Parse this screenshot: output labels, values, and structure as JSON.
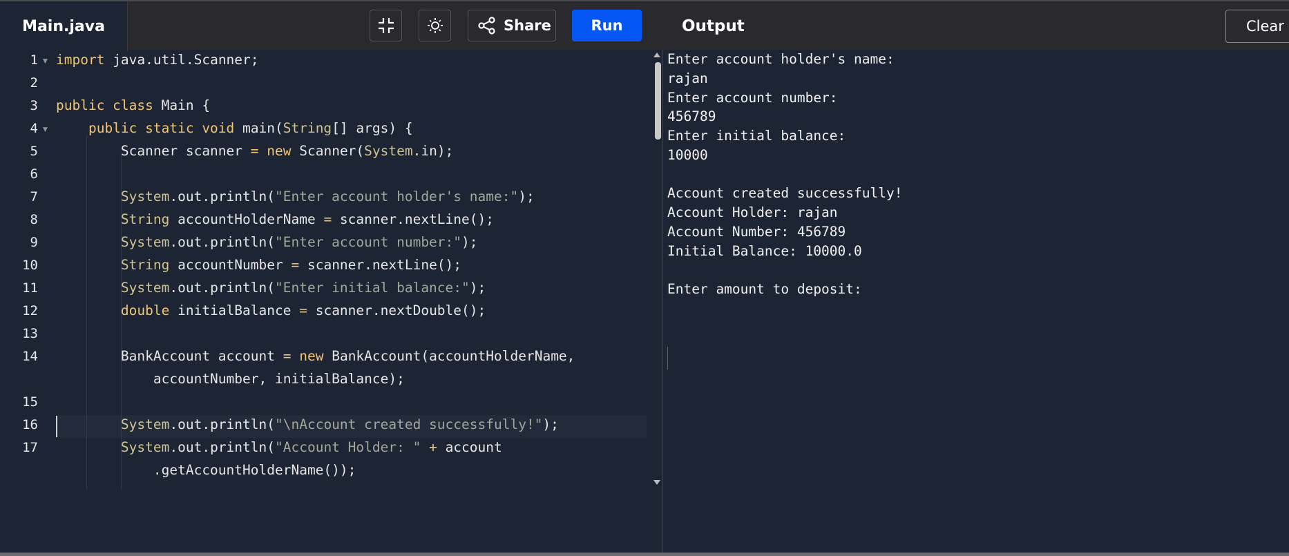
{
  "header": {
    "tab_label": "Main.java",
    "share_label": "Share",
    "run_label": "Run",
    "output_title": "Output",
    "clear_label": "Clear"
  },
  "icons": {
    "fullscreen": "collapse-icon",
    "theme": "sun-icon",
    "share": "share-icon"
  },
  "colors": {
    "run_button": "#0556f3",
    "editor_bg": "#1d2433",
    "keyword": "#f0c674",
    "string": "#a3a79a"
  },
  "editor": {
    "line_numbers": [
      "1",
      "2",
      "3",
      "4",
      "5",
      "6",
      "7",
      "8",
      "9",
      "10",
      "11",
      "12",
      "13",
      "14",
      "15",
      "16",
      "17"
    ],
    "lines": [
      {
        "segments": [
          {
            "t": "import",
            "c": "kw"
          },
          {
            "t": " java.util.Scanner;",
            "c": ""
          }
        ]
      },
      {
        "segments": []
      },
      {
        "segments": [
          {
            "t": "public class",
            "c": "kw"
          },
          {
            "t": " Main {",
            "c": ""
          }
        ]
      },
      {
        "segments": [
          {
            "t": "    public static void",
            "c": "kw"
          },
          {
            "t": " main(",
            "c": ""
          },
          {
            "t": "String",
            "c": "kw2"
          },
          {
            "t": "[] args) {",
            "c": ""
          }
        ]
      },
      {
        "segments": [
          {
            "t": "        Scanner scanner ",
            "c": ""
          },
          {
            "t": "=",
            "c": "op"
          },
          {
            "t": " ",
            "c": ""
          },
          {
            "t": "new",
            "c": "kw"
          },
          {
            "t": " Scanner(",
            "c": ""
          },
          {
            "t": "System",
            "c": "kw2"
          },
          {
            "t": ".in);",
            "c": ""
          }
        ]
      },
      {
        "segments": []
      },
      {
        "segments": [
          {
            "t": "        ",
            "c": ""
          },
          {
            "t": "System",
            "c": "kw2"
          },
          {
            "t": ".out.println(",
            "c": ""
          },
          {
            "t": "\"Enter account holder's name:\"",
            "c": "str"
          },
          {
            "t": ");",
            "c": ""
          }
        ]
      },
      {
        "segments": [
          {
            "t": "        ",
            "c": ""
          },
          {
            "t": "String",
            "c": "kw2"
          },
          {
            "t": " accountHolderName ",
            "c": ""
          },
          {
            "t": "=",
            "c": "op"
          },
          {
            "t": " scanner.nextLine();",
            "c": ""
          }
        ]
      },
      {
        "segments": [
          {
            "t": "        ",
            "c": ""
          },
          {
            "t": "System",
            "c": "kw2"
          },
          {
            "t": ".out.println(",
            "c": ""
          },
          {
            "t": "\"Enter account number:\"",
            "c": "str"
          },
          {
            "t": ");",
            "c": ""
          }
        ]
      },
      {
        "segments": [
          {
            "t": "        ",
            "c": ""
          },
          {
            "t": "String",
            "c": "kw2"
          },
          {
            "t": " accountNumber ",
            "c": ""
          },
          {
            "t": "=",
            "c": "op"
          },
          {
            "t": " scanner.nextLine();",
            "c": ""
          }
        ]
      },
      {
        "segments": [
          {
            "t": "        ",
            "c": ""
          },
          {
            "t": "System",
            "c": "kw2"
          },
          {
            "t": ".out.println(",
            "c": ""
          },
          {
            "t": "\"Enter initial balance:\"",
            "c": "str"
          },
          {
            "t": ");",
            "c": ""
          }
        ]
      },
      {
        "segments": [
          {
            "t": "        ",
            "c": ""
          },
          {
            "t": "double",
            "c": "kw"
          },
          {
            "t": " initialBalance ",
            "c": ""
          },
          {
            "t": "=",
            "c": "op"
          },
          {
            "t": " scanner.nextDouble();",
            "c": ""
          }
        ]
      },
      {
        "segments": []
      },
      {
        "segments": [
          {
            "t": "        BankAccount account ",
            "c": ""
          },
          {
            "t": "=",
            "c": "op"
          },
          {
            "t": " ",
            "c": ""
          },
          {
            "t": "new",
            "c": "kw"
          },
          {
            "t": " BankAccount(accountHolderName,",
            "c": ""
          }
        ]
      },
      {
        "segments": [
          {
            "t": "            accountNumber, initialBalance);",
            "c": ""
          }
        ]
      },
      {
        "segments": []
      },
      {
        "segments": [
          {
            "t": "        ",
            "c": ""
          },
          {
            "t": "System",
            "c": "kw2"
          },
          {
            "t": ".out.println(",
            "c": ""
          },
          {
            "t": "\"\\nAccount created successfully!\"",
            "c": "str"
          },
          {
            "t": ");",
            "c": ""
          }
        ]
      },
      {
        "segments": [
          {
            "t": "        ",
            "c": ""
          },
          {
            "t": "System",
            "c": "kw2"
          },
          {
            "t": ".out.println(",
            "c": ""
          },
          {
            "t": "\"Account Holder: \"",
            "c": "str"
          },
          {
            "t": " ",
            "c": ""
          },
          {
            "t": "+",
            "c": "op"
          },
          {
            "t": " account",
            "c": ""
          }
        ]
      },
      {
        "segments": [
          {
            "t": "            .getAccountHolderName());",
            "c": ""
          }
        ]
      }
    ]
  },
  "output": {
    "lines": [
      "Enter account holder's name:",
      "rajan",
      "Enter account number:",
      "456789",
      "Enter initial balance:",
      "10000",
      "",
      "Account created successfully!",
      "Account Holder: rajan",
      "Account Number: 456789",
      "Initial Balance: 10000.0",
      "",
      "Enter amount to deposit:"
    ]
  }
}
